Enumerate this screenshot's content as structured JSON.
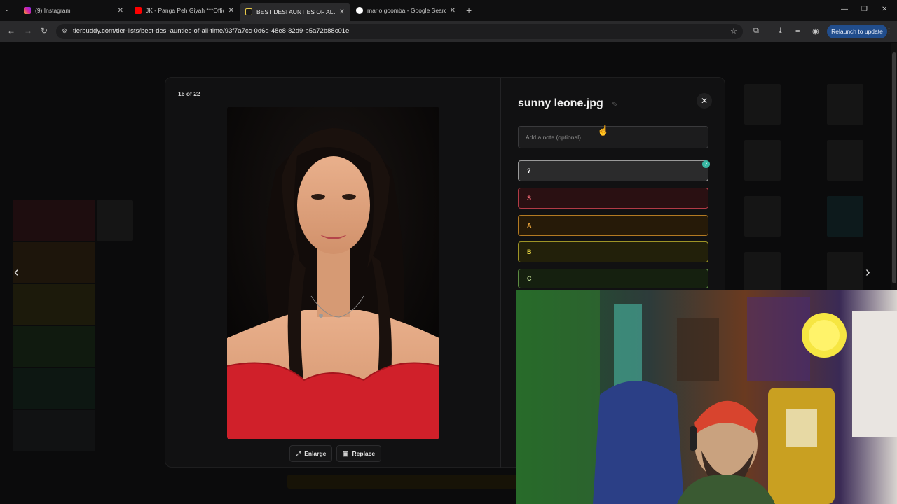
{
  "browser": {
    "tabs": [
      {
        "title": "(9) Instagram",
        "icon": "instagram-icon",
        "color": "#d6249f",
        "active": false
      },
      {
        "title": "JK - Panga Peh Giyah ***Official",
        "icon": "youtube-icon",
        "color": "#ff0000",
        "active": false
      },
      {
        "title": "BEST DESI AUNTIES OF ALL TIME",
        "icon": "tierbuddy-icon",
        "color": "#e6c84a",
        "active": true
      },
      {
        "title": "mario goomba - Google Search",
        "icon": "google-icon",
        "color": "#4285f4",
        "active": false
      }
    ],
    "url": "tierbuddy.com/tier-lists/best-desi-aunties-of-all-time/93f7a7cc-0d6d-48e8-82d9-b5a72b88c01e",
    "relaunch_label": "Relaunch to update"
  },
  "modal": {
    "counter": "16 of 22",
    "image_name": "sunny leone.jpg",
    "note_placeholder": "Add a note (optional)",
    "enlarge_label": "Enlarge",
    "replace_label": "Replace",
    "tiers": [
      {
        "label": "?",
        "selected": true
      },
      {
        "label": "S",
        "color": "#f46a76"
      },
      {
        "label": "A",
        "color": "#e6a23b"
      },
      {
        "label": "B",
        "color": "#d8c93e"
      },
      {
        "label": "C",
        "color": "#b7d28d"
      }
    ]
  }
}
